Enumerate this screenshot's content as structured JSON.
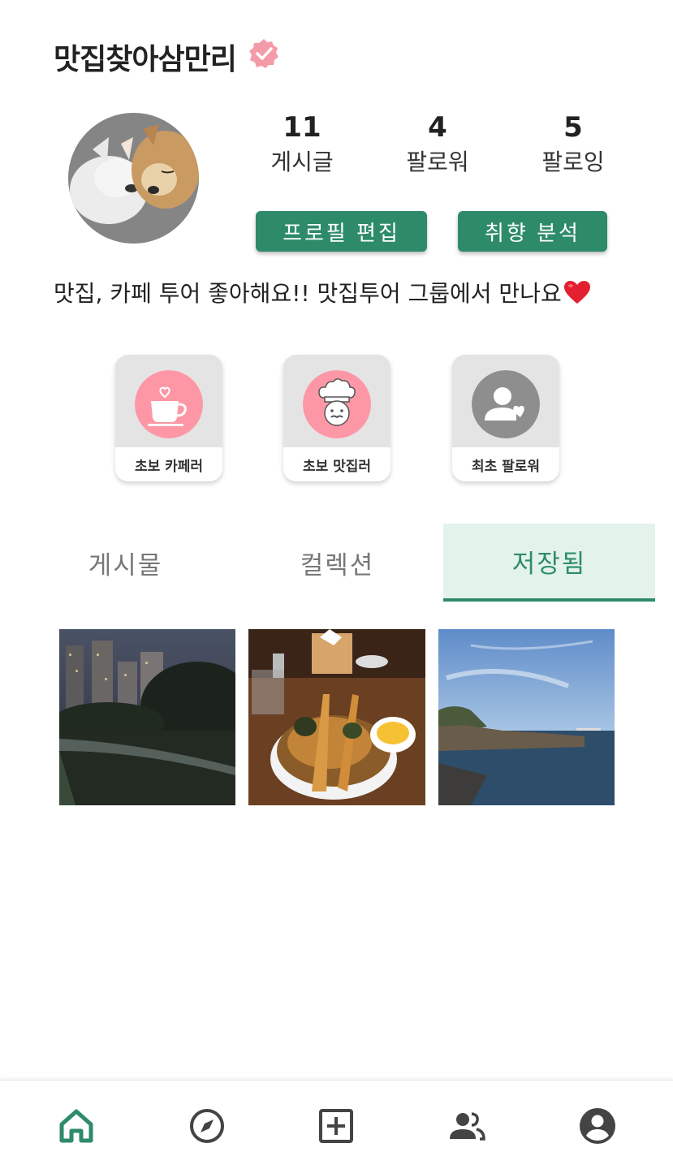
{
  "profile": {
    "username": "맛집찾아삼만리",
    "bio": "맛집, 카페 투어 좋아해요!! 맛집투어 그룹에서 만나요"
  },
  "stats": [
    {
      "value": "11",
      "label": "게시글"
    },
    {
      "value": "4",
      "label": "팔로워"
    },
    {
      "value": "5",
      "label": "팔로잉"
    }
  ],
  "actions": {
    "edit_profile": "프로필 편집",
    "taste_analysis": "취향 분석"
  },
  "badges": [
    {
      "label": "초보 카페러",
      "icon": "coffee-cup-icon"
    },
    {
      "label": "초보 맛집러",
      "icon": "chef-icon"
    },
    {
      "label": "최초 팔로워",
      "icon": "person-heart-icon"
    }
  ],
  "tabs": [
    {
      "label": "게시물",
      "active": false
    },
    {
      "label": "컬렉션",
      "active": false
    },
    {
      "label": "저장됨",
      "active": true
    }
  ],
  "bottom_nav": [
    {
      "icon": "home-icon",
      "active": true
    },
    {
      "icon": "compass-icon",
      "active": false
    },
    {
      "icon": "add-box-icon",
      "active": false
    },
    {
      "icon": "group-icon",
      "active": false
    },
    {
      "icon": "account-icon",
      "active": false
    }
  ],
  "colors": {
    "accent": "#2e8b6a",
    "accent_light": "#e3f3ec",
    "badge_pink": "#fd97a6",
    "badge_grey": "#8e8e8e",
    "verified_pink": "#f59aa8"
  }
}
